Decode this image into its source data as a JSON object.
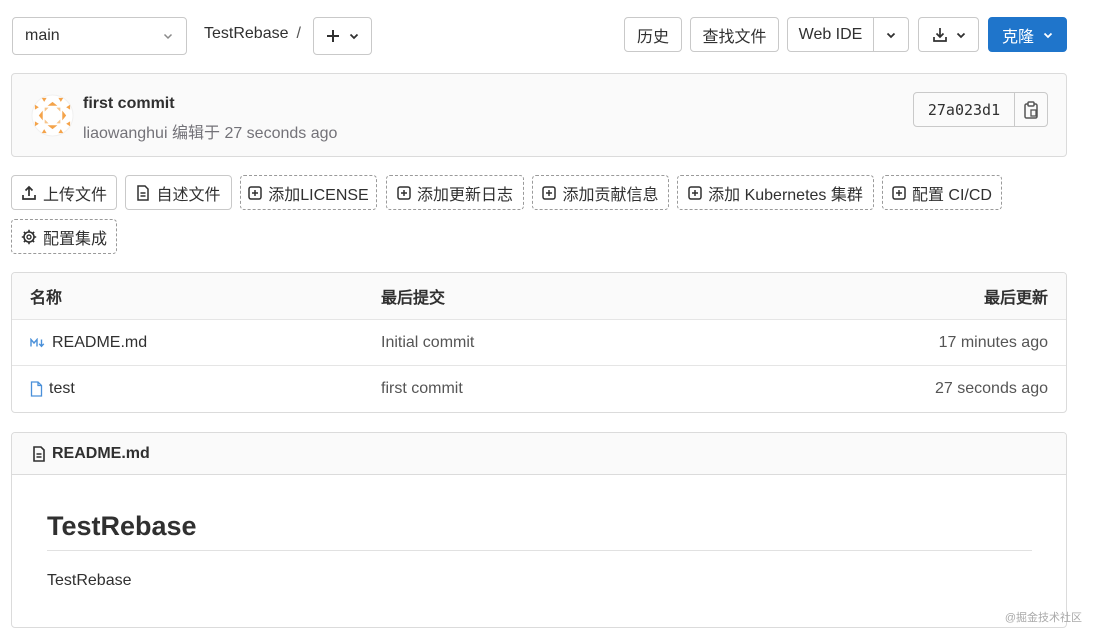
{
  "toolbar": {
    "branch": "main",
    "project": "TestRebase",
    "separator": "/",
    "history": "历史",
    "find_file": "查找文件",
    "web_ide": "Web IDE",
    "clone": "克隆"
  },
  "commit": {
    "title": "first commit",
    "author": "liaowanghui",
    "action": "编辑于",
    "time": "27 seconds ago",
    "sha": "27a023d1"
  },
  "quick_actions": [
    {
      "label": "上传文件",
      "icon": "upload-icon"
    },
    {
      "label": "自述文件",
      "icon": "doc-icon"
    },
    {
      "label": "添加LICENSE",
      "icon": "plus-square-icon"
    },
    {
      "label": "添加更新日志",
      "icon": "plus-square-icon"
    },
    {
      "label": "添加贡献信息",
      "icon": "plus-square-icon"
    },
    {
      "label": "添加 Kubernetes 集群",
      "icon": "plus-square-icon"
    },
    {
      "label": "配置 CI/CD",
      "icon": "plus-square-icon"
    },
    {
      "label": "配置集成",
      "icon": "settings-icon"
    }
  ],
  "table": {
    "headers": [
      "名称",
      "最后提交",
      "最后更新"
    ],
    "rows": [
      {
        "name": "README.md",
        "commit": "Initial commit",
        "updated": "17 minutes ago",
        "icon": "markdown-icon"
      },
      {
        "name": "test",
        "commit": "first commit",
        "updated": "27 seconds ago",
        "icon": "file-icon"
      }
    ]
  },
  "readme": {
    "filename": "README.md",
    "heading": "TestRebase",
    "body": "TestRebase"
  },
  "watermark": "@掘金技术社区",
  "colors": {
    "primary": "#1f75cb",
    "border": "#dbdbdb",
    "panel_bg": "#fafafa",
    "muted": "#737278"
  }
}
